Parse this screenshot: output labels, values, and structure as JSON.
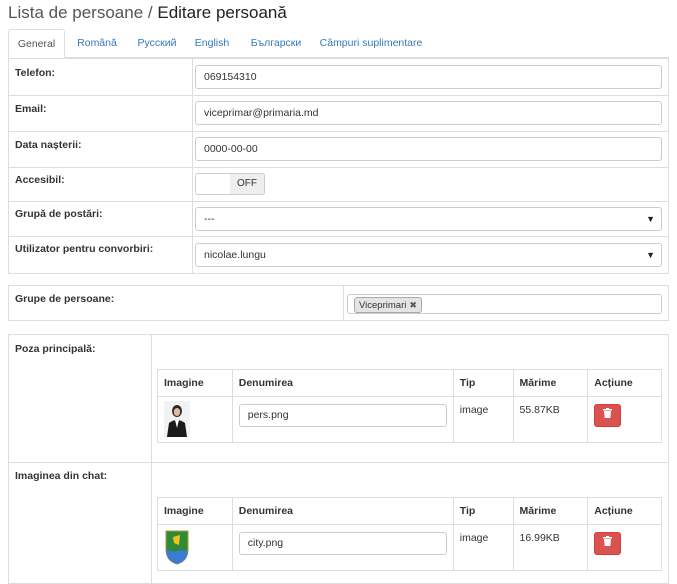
{
  "header": {
    "breadcrumb_parent": "Lista de persoane",
    "separator": "/",
    "title": "Editare persoană"
  },
  "tabs": [
    {
      "label": "General",
      "active": true
    },
    {
      "label": "Română"
    },
    {
      "label": "Русский"
    },
    {
      "label": "English"
    },
    {
      "label": "Български"
    },
    {
      "label": "Câmpuri suplimentare"
    }
  ],
  "form": {
    "phone": {
      "label": "Telefon:",
      "value": "069154310"
    },
    "email": {
      "label": "Email:",
      "value": "viceprimar@primaria.md"
    },
    "birthdate": {
      "label": "Data nașterii:",
      "value": "0000-00-00"
    },
    "accessible": {
      "label": "Accesibil:",
      "state": "OFF"
    },
    "posting_group": {
      "label": "Grupă de postări:",
      "value": "---"
    },
    "chat_user": {
      "label": "Utilizator pentru convorbiri:",
      "value": "nicolae.lungu"
    },
    "person_groups": {
      "label": "Grupe de persoane:",
      "tags": [
        "Viceprimari"
      ]
    }
  },
  "images": {
    "columns": {
      "image": "Imagine",
      "name": "Denumirea",
      "type": "Tip",
      "size": "Mărime",
      "action": "Acțiune"
    },
    "main_photo": {
      "label": "Poza principală:",
      "file": {
        "name": "pers.png",
        "type": "image",
        "size": "55.87KB"
      }
    },
    "chat_image": {
      "label": "Imaginea din chat:",
      "file": {
        "name": "city.png",
        "type": "image",
        "size": "16.99KB"
      }
    }
  },
  "colors": {
    "link": "#337ab7",
    "danger": "#d9534f",
    "border": "#dddddd"
  },
  "icons": {
    "delete": "trash-icon",
    "select_arrow": "caret-down-icon",
    "tag_remove": "close-icon"
  }
}
